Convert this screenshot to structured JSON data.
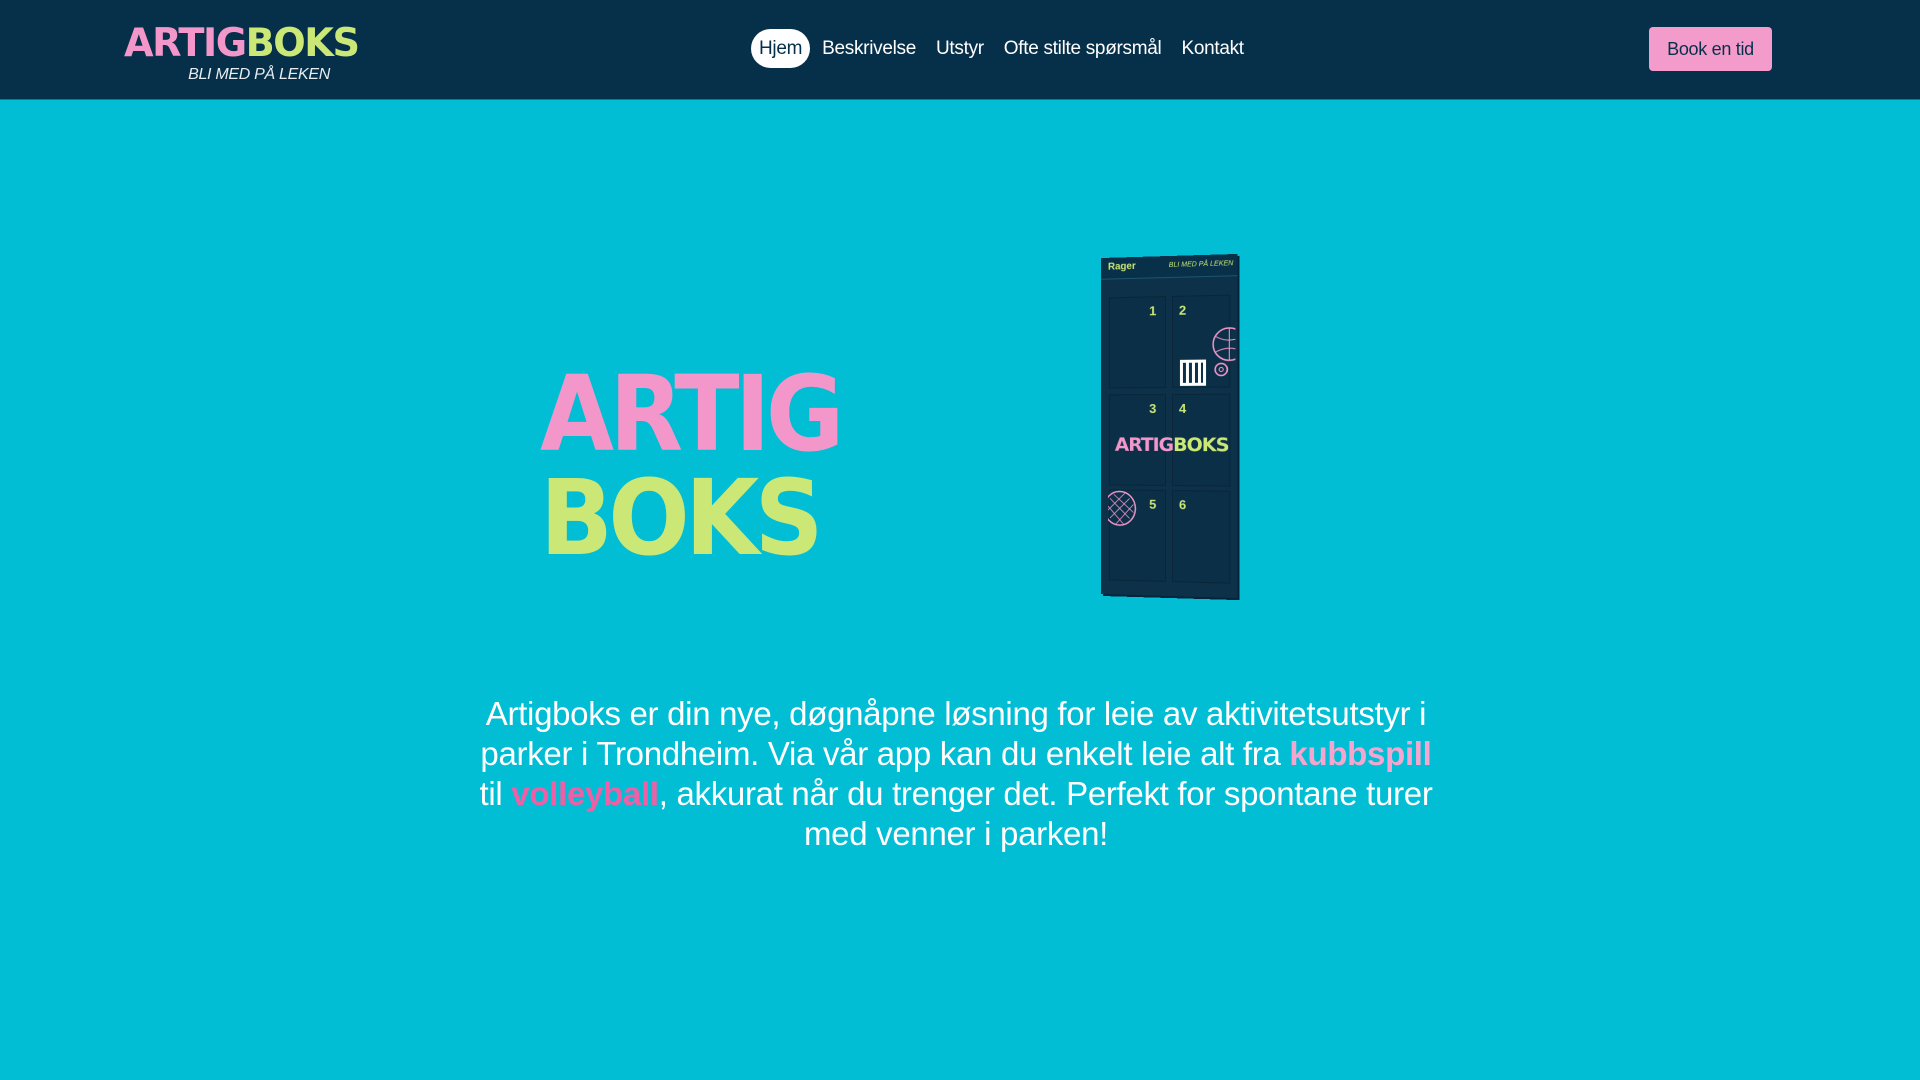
{
  "header": {
    "logo": {
      "part1": "ARTIG",
      "part2": "BOKS",
      "tagline": "BLI MED PÅ LEKEN"
    },
    "nav": [
      {
        "label": "Hjem",
        "active": true
      },
      {
        "label": "Beskrivelse",
        "active": false
      },
      {
        "label": "Utstyr",
        "active": false
      },
      {
        "label": "Ofte stilte spørsmål",
        "active": false
      },
      {
        "label": "Kontakt",
        "active": false
      }
    ],
    "book_button": "Book en tid"
  },
  "hero": {
    "logo_line1": "ARTIG",
    "logo_line2": "BOKS",
    "locker": {
      "location": "Rager",
      "slogan": "BLI MED PÅ LEKEN",
      "cells": [
        "1",
        "2",
        "3",
        "4",
        "5",
        "6"
      ],
      "brand_part1": "ARTIG",
      "brand_part2": "BOKS"
    }
  },
  "description": {
    "part1": "Artigboks er din nye, døgnåpne løsning for leie av aktivitetsutstyr i parker i Trondheim. Via vår app kan du enkelt leie alt fra ",
    "highlight1": "kubbspill",
    "part2": " til ",
    "highlight2": "volleyball",
    "part3": ", akkurat når du trenger det. Perfekt for spontane turer med venner i parken!"
  },
  "colors": {
    "background": "#02bed5",
    "header": "#06304a",
    "pink": "#f397cb",
    "lime": "#cbe877",
    "hot_pink": "#ef5fa6"
  }
}
